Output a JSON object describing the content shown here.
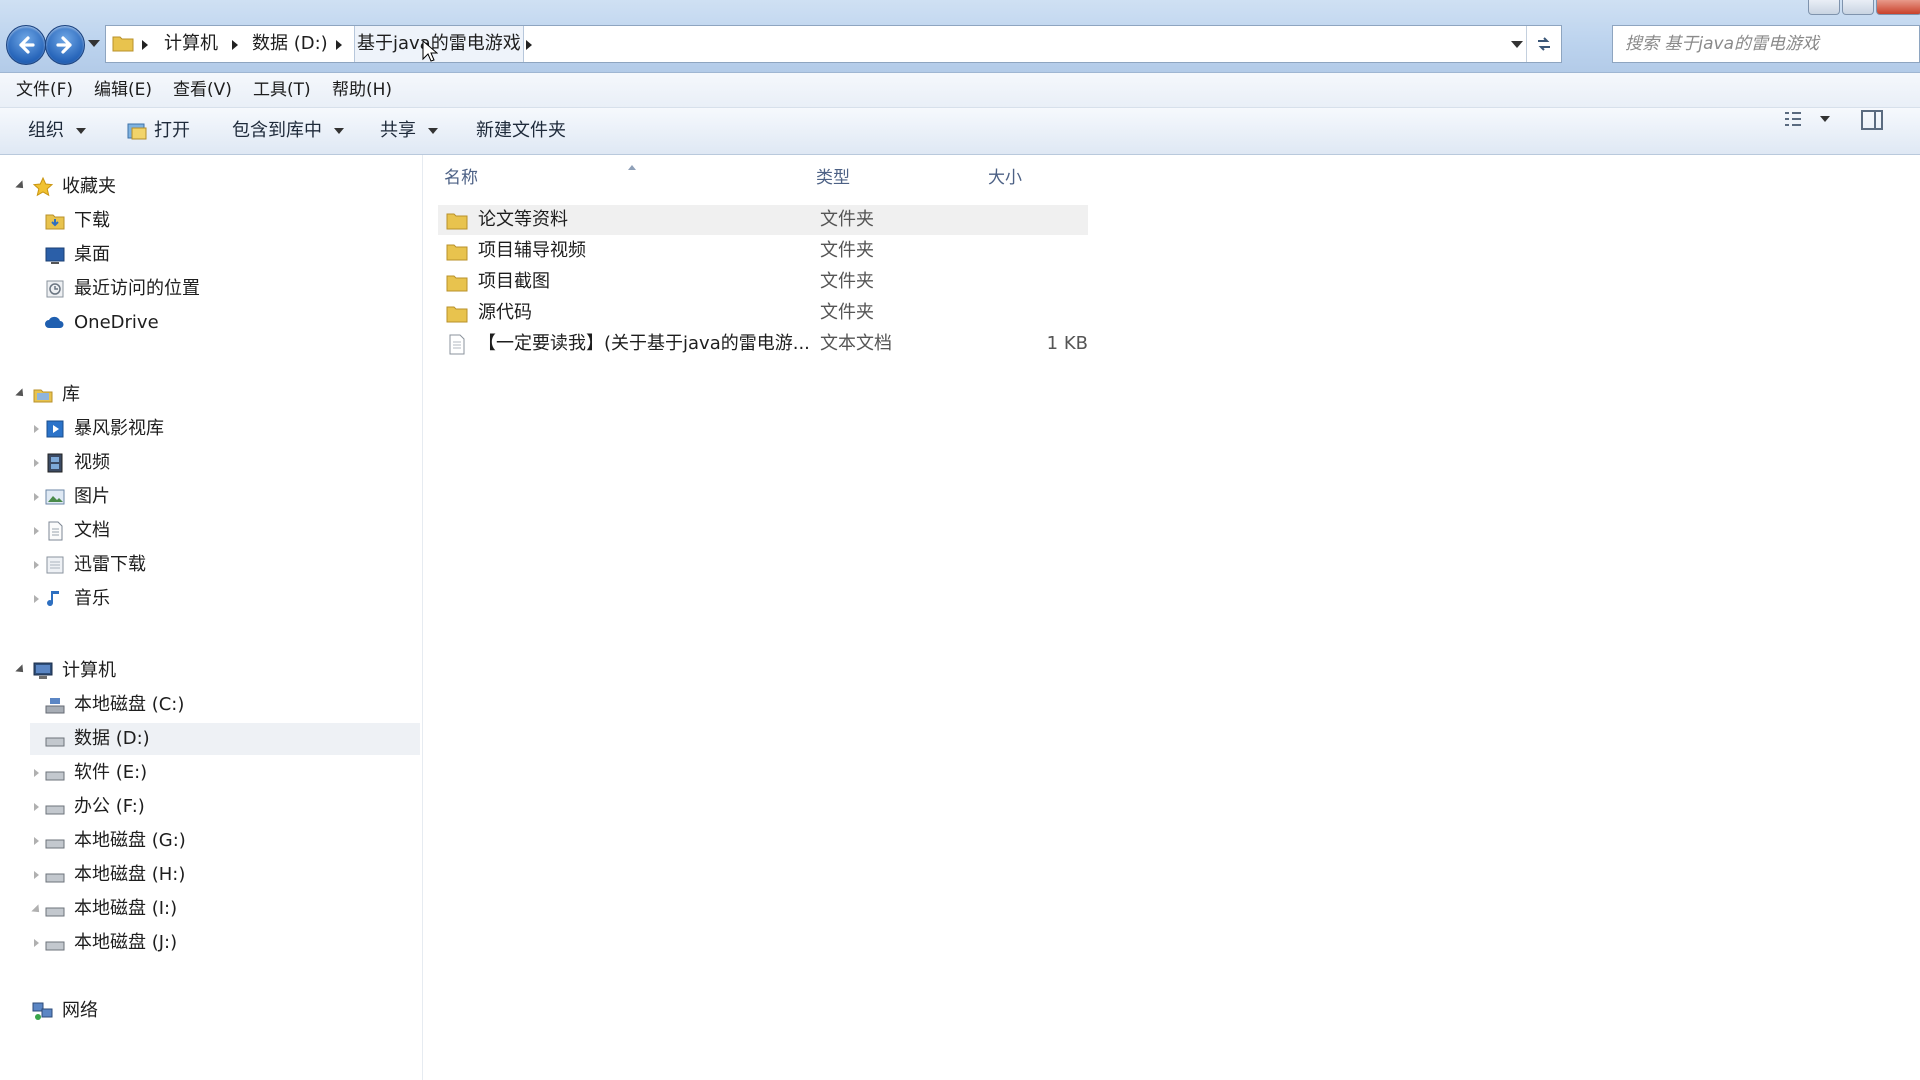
{
  "window": {
    "breadcrumb": [
      "计算机",
      "数据 (D:)",
      "基于java的雷电游戏"
    ],
    "search_placeholder": "搜索 基于java的雷电游戏"
  },
  "menu": [
    "文件(F)",
    "编辑(E)",
    "查看(V)",
    "工具(T)",
    "帮助(H)"
  ],
  "toolbar": {
    "organize": "组织",
    "open": "打开",
    "include_library": "包含到库中",
    "share": "共享",
    "new_folder": "新建文件夹"
  },
  "nav": {
    "favorites": {
      "label": "收藏夹",
      "items": [
        "下载",
        "桌面",
        "最近访问的位置",
        "OneDrive"
      ]
    },
    "libraries": {
      "label": "库",
      "items": [
        "暴风影视库",
        "视频",
        "图片",
        "文档",
        "迅雷下载",
        "音乐"
      ]
    },
    "computer": {
      "label": "计算机",
      "items": [
        "本地磁盘 (C:)",
        "数据 (D:)",
        "软件 (E:)",
        "办公 (F:)",
        "本地磁盘 (G:)",
        "本地磁盘 (H:)",
        "本地磁盘 (I:)",
        "本地磁盘 (J:)"
      ],
      "selected": "数据 (D:)"
    },
    "network": {
      "label": "网络"
    }
  },
  "columns": {
    "name": "名称",
    "type": "类型",
    "size": "大小"
  },
  "files": [
    {
      "name": "论文等资料",
      "type": "文件夹",
      "size": "",
      "kind": "folder"
    },
    {
      "name": "项目辅导视频",
      "type": "文件夹",
      "size": "",
      "kind": "folder"
    },
    {
      "name": "项目截图",
      "type": "文件夹",
      "size": "",
      "kind": "folder"
    },
    {
      "name": "源代码",
      "type": "文件夹",
      "size": "",
      "kind": "folder"
    },
    {
      "name": "【一定要读我】(关于基于java的雷电游...",
      "type": "文本文档",
      "size": "1 KB",
      "kind": "text"
    }
  ]
}
